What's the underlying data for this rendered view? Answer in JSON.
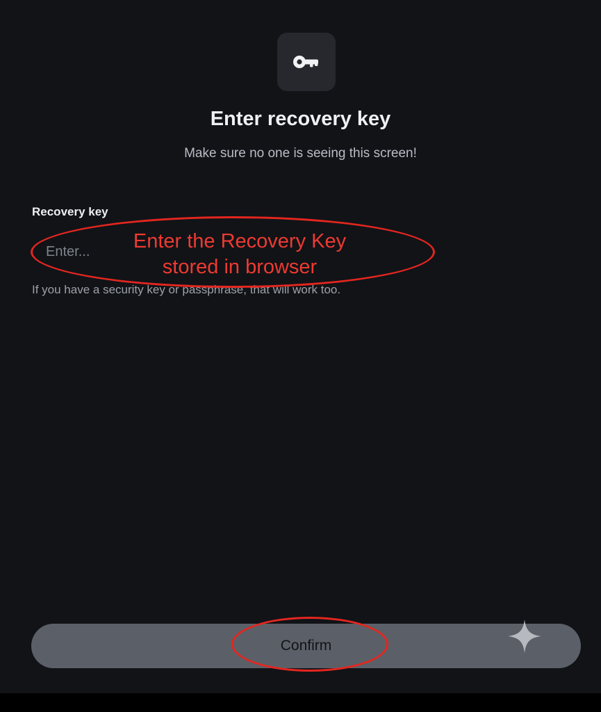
{
  "header": {
    "icon": "key-icon",
    "title": "Enter recovery key",
    "subtitle": "Make sure no one is seeing this screen!"
  },
  "form": {
    "label": "Recovery key",
    "placeholder": "Enter...",
    "value": "",
    "hint": "If you have a security key or passphrase, that will work too."
  },
  "annotation": {
    "line1": "Enter the Recovery Key",
    "line2": "stored in browser",
    "color": "#e3261f"
  },
  "actions": {
    "confirm_label": "Confirm"
  },
  "decor": {
    "sparkle_icon": "sparkle-icon"
  },
  "colors": {
    "background": "#111317",
    "tile": "#26282d",
    "button": "#5b6068"
  }
}
